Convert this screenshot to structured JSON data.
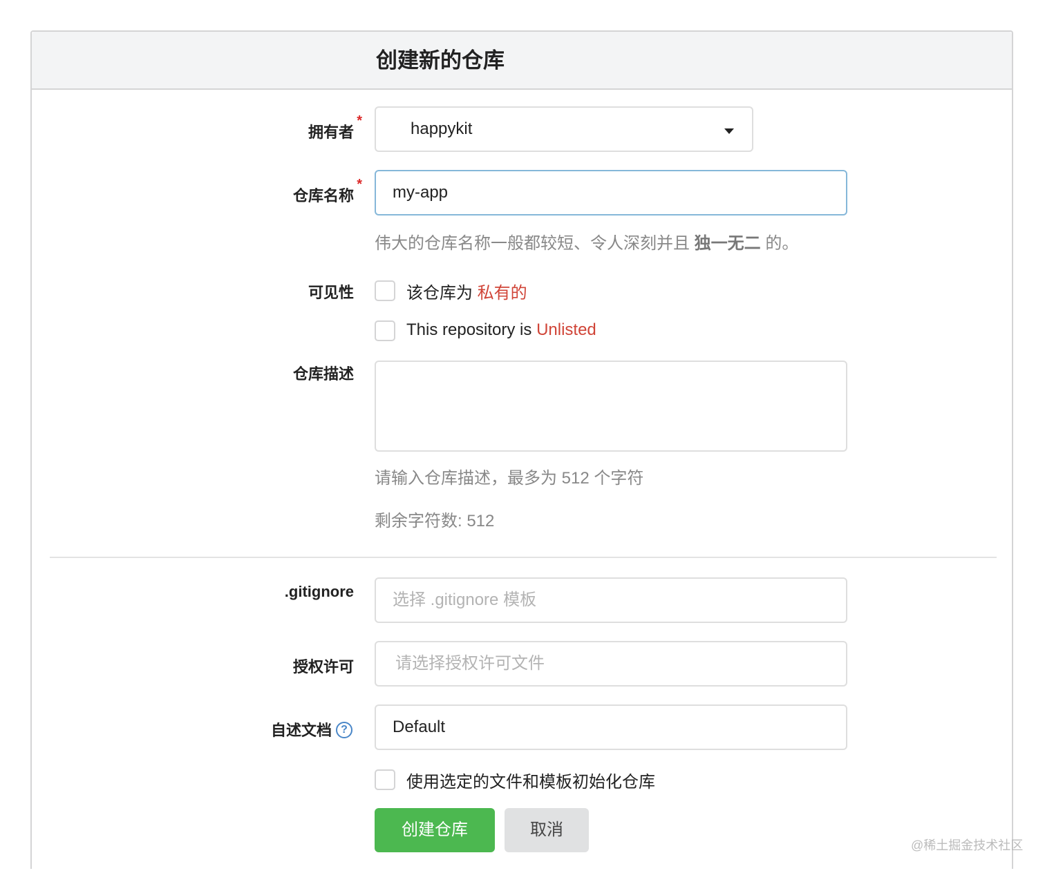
{
  "header": {
    "title": "创建新的仓库"
  },
  "owner": {
    "label": "拥有者",
    "required_mark": "*",
    "value": "happykit"
  },
  "repo_name": {
    "label": "仓库名称",
    "required_mark": "*",
    "value": "my-app",
    "help_prefix": "伟大的仓库名称一般都较短、令人深刻并且 ",
    "help_bold": "独一无二",
    "help_suffix": " 的。"
  },
  "visibility": {
    "label": "可见性",
    "private_prefix": "该仓库为 ",
    "private_highlight": "私有的",
    "unlisted_prefix": "This repository is ",
    "unlisted_highlight": "Unlisted"
  },
  "description": {
    "label": "仓库描述",
    "help": "请输入仓库描述，最多为 512 个字符",
    "remaining": "剩余字符数: 512"
  },
  "gitignore": {
    "label": ".gitignore",
    "placeholder": "选择 .gitignore 模板"
  },
  "license": {
    "label": "授权许可",
    "placeholder": "请选择授权许可文件"
  },
  "readme": {
    "label": "自述文档",
    "help_icon": "?",
    "value": "Default"
  },
  "auto_init": {
    "label": "使用选定的文件和模板初始化仓库"
  },
  "buttons": {
    "create": "创建仓库",
    "cancel": "取消"
  },
  "watermark": "@稀土掘金技术社区",
  "colors": {
    "primary_button": "#4cb850",
    "highlight": "#d04437",
    "focus_border": "#85b7d9"
  }
}
